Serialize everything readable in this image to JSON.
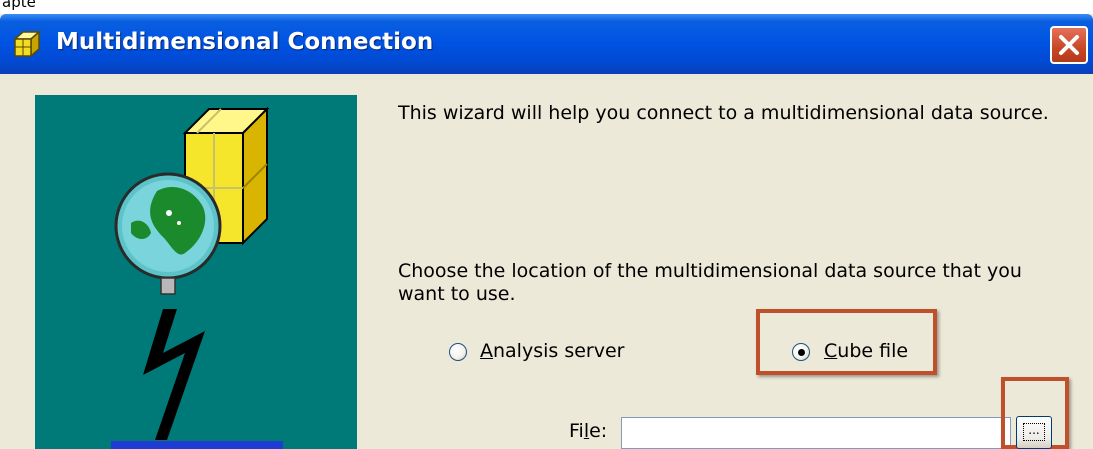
{
  "top_strip": {
    "text": "apte"
  },
  "window": {
    "title": "Multidimensional Connection",
    "close_label": ""
  },
  "wizard": {
    "intro": "This wizard will help you connect to a multidimensional data source.",
    "choose_line1": "Choose the location of the multidimensional data source that you",
    "choose_line2": "want to use.",
    "radio_analysis": {
      "accel": "A",
      "rest": "nalysis server",
      "selected": false
    },
    "radio_cube": {
      "accel": "C",
      "rest": "ube file",
      "selected": true
    },
    "file_label_pre": "Fi",
    "file_label_accel": "l",
    "file_label_post": "e:",
    "file_value": "",
    "browse_label": "..."
  },
  "colors": {
    "titlebar": "#0054e3",
    "panel": "#007a78",
    "dialog_bg": "#ece9d8",
    "highlight": "#c0502c",
    "close": "#c74725"
  },
  "icons": [
    "cube-icon",
    "close-icon",
    "cube-globe-lightning-illustration",
    "ellipsis-icon"
  ]
}
